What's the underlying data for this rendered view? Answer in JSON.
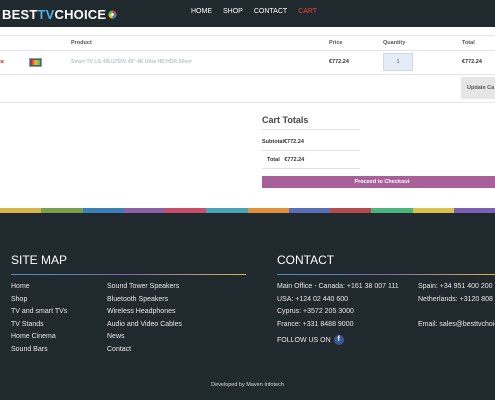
{
  "header": {
    "logo": {
      "part1": "BEST",
      "part2": "TV",
      "part3": "CHOICE"
    },
    "nav": [
      {
        "label": "HOME",
        "color": "#ffffff"
      },
      {
        "label": "SHOP",
        "color": "#ffffff"
      },
      {
        "label": "CONTACT",
        "color": "#ffffff"
      },
      {
        "label": "CART",
        "color": "#e8453c"
      }
    ]
  },
  "cart": {
    "columns": {
      "product": "Product",
      "price": "Price",
      "quantity": "Quantity",
      "total": "Total"
    },
    "items": [
      {
        "remove": "×",
        "product": "Smart TV LG 49UJ750V 49\" 4K Ultra HD HDR Silver",
        "price": "€772.24",
        "quantity": "1",
        "total": "€772.24"
      }
    ],
    "update_label": "Update Ca",
    "totals": {
      "title": "Cart Totals",
      "subtotal_label": "Subtotal",
      "subtotal_value": "€772.24",
      "total_label": "Total",
      "total_value": "€772.24",
      "checkout_label": "Proceed to Checkout"
    }
  },
  "footer": {
    "stripe_colors": [
      "#d9b54a",
      "#7a9e4a",
      "#3a7fb5",
      "#8e5fa6",
      "#c94d6a",
      "#4aa3b5",
      "#e0903a",
      "#5a6eb8",
      "#b54a4a",
      "#4ab57a",
      "#d9c14a",
      "#7a5fb5"
    ],
    "sitemap": {
      "title": "SITE MAP",
      "col1": [
        "Home",
        "Shop",
        "TV and smart TVs",
        "TV Stands",
        "Home Cinema",
        "Sound Bars"
      ],
      "col2": [
        "Sound Tower Speakers",
        "Bluetooth Speakers",
        "Wireless Headphones",
        "Audio and Video Cables",
        "News",
        "Contact"
      ]
    },
    "contact": {
      "title": "CONTACT",
      "col1": [
        "Main Office - Canada: +161 38 007 111",
        "USA: +124 02 440 600",
        "Cyprus: +3572 205 3000",
        "France: +331 8488 9000"
      ],
      "col2": [
        "Spain: +34 951 400 200",
        "Netherlands: +3120 808 7",
        "",
        "Email: sales@besttvchoice"
      ],
      "follow": "FOLLOW US ON",
      "fb": "f"
    },
    "developed_prefix": "Developed by",
    "developer": "Maven Infotech"
  }
}
